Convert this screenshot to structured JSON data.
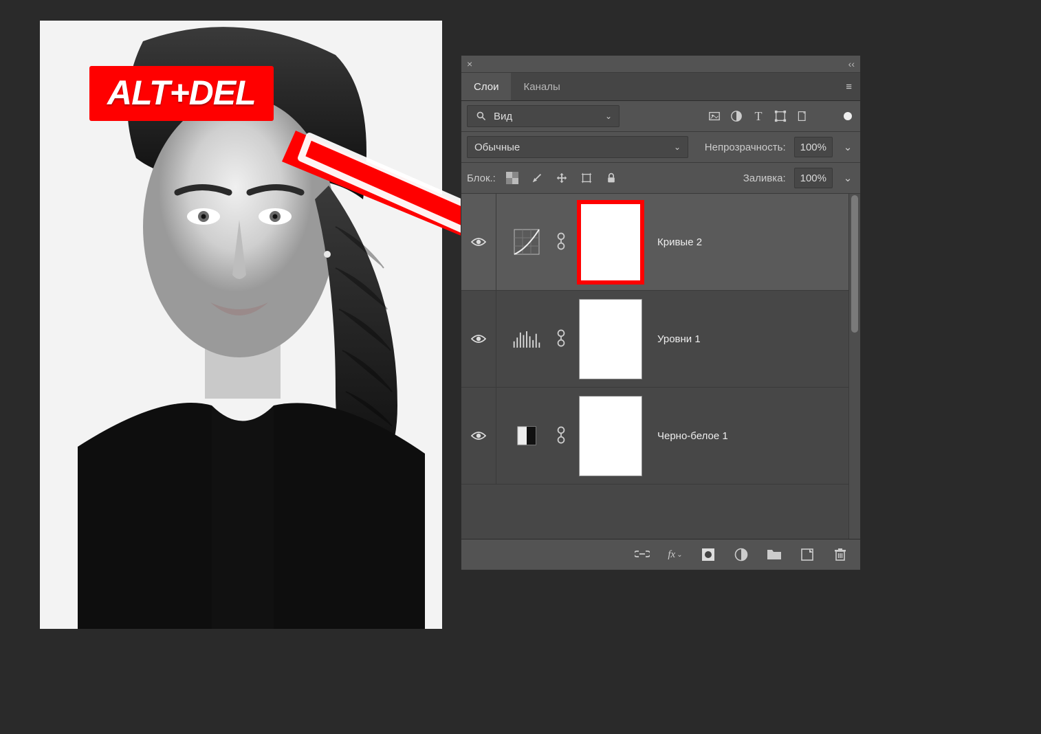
{
  "badge": {
    "text": "ALT+DEL"
  },
  "panel": {
    "close": "×",
    "collapse": "‹‹",
    "tabs": {
      "layers": "Слои",
      "channels": "Каналы"
    },
    "menu": "≡",
    "filter": {
      "label": "Вид"
    },
    "blend": {
      "mode": "Обычные",
      "opacity_label": "Непрозрачность:",
      "opacity_value": "100%"
    },
    "lock": {
      "label": "Блок.:",
      "fill_label": "Заливка:",
      "fill_value": "100%"
    },
    "layers": [
      {
        "name": "Кривые 2",
        "icon": "curves",
        "selected": true,
        "mask_hilite": true
      },
      {
        "name": "Уровни 1",
        "icon": "levels",
        "selected": false,
        "mask_hilite": false
      },
      {
        "name": "Черно-белое 1",
        "icon": "bw",
        "selected": false,
        "mask_hilite": false
      }
    ],
    "bottom": {
      "fx": "fx"
    }
  }
}
